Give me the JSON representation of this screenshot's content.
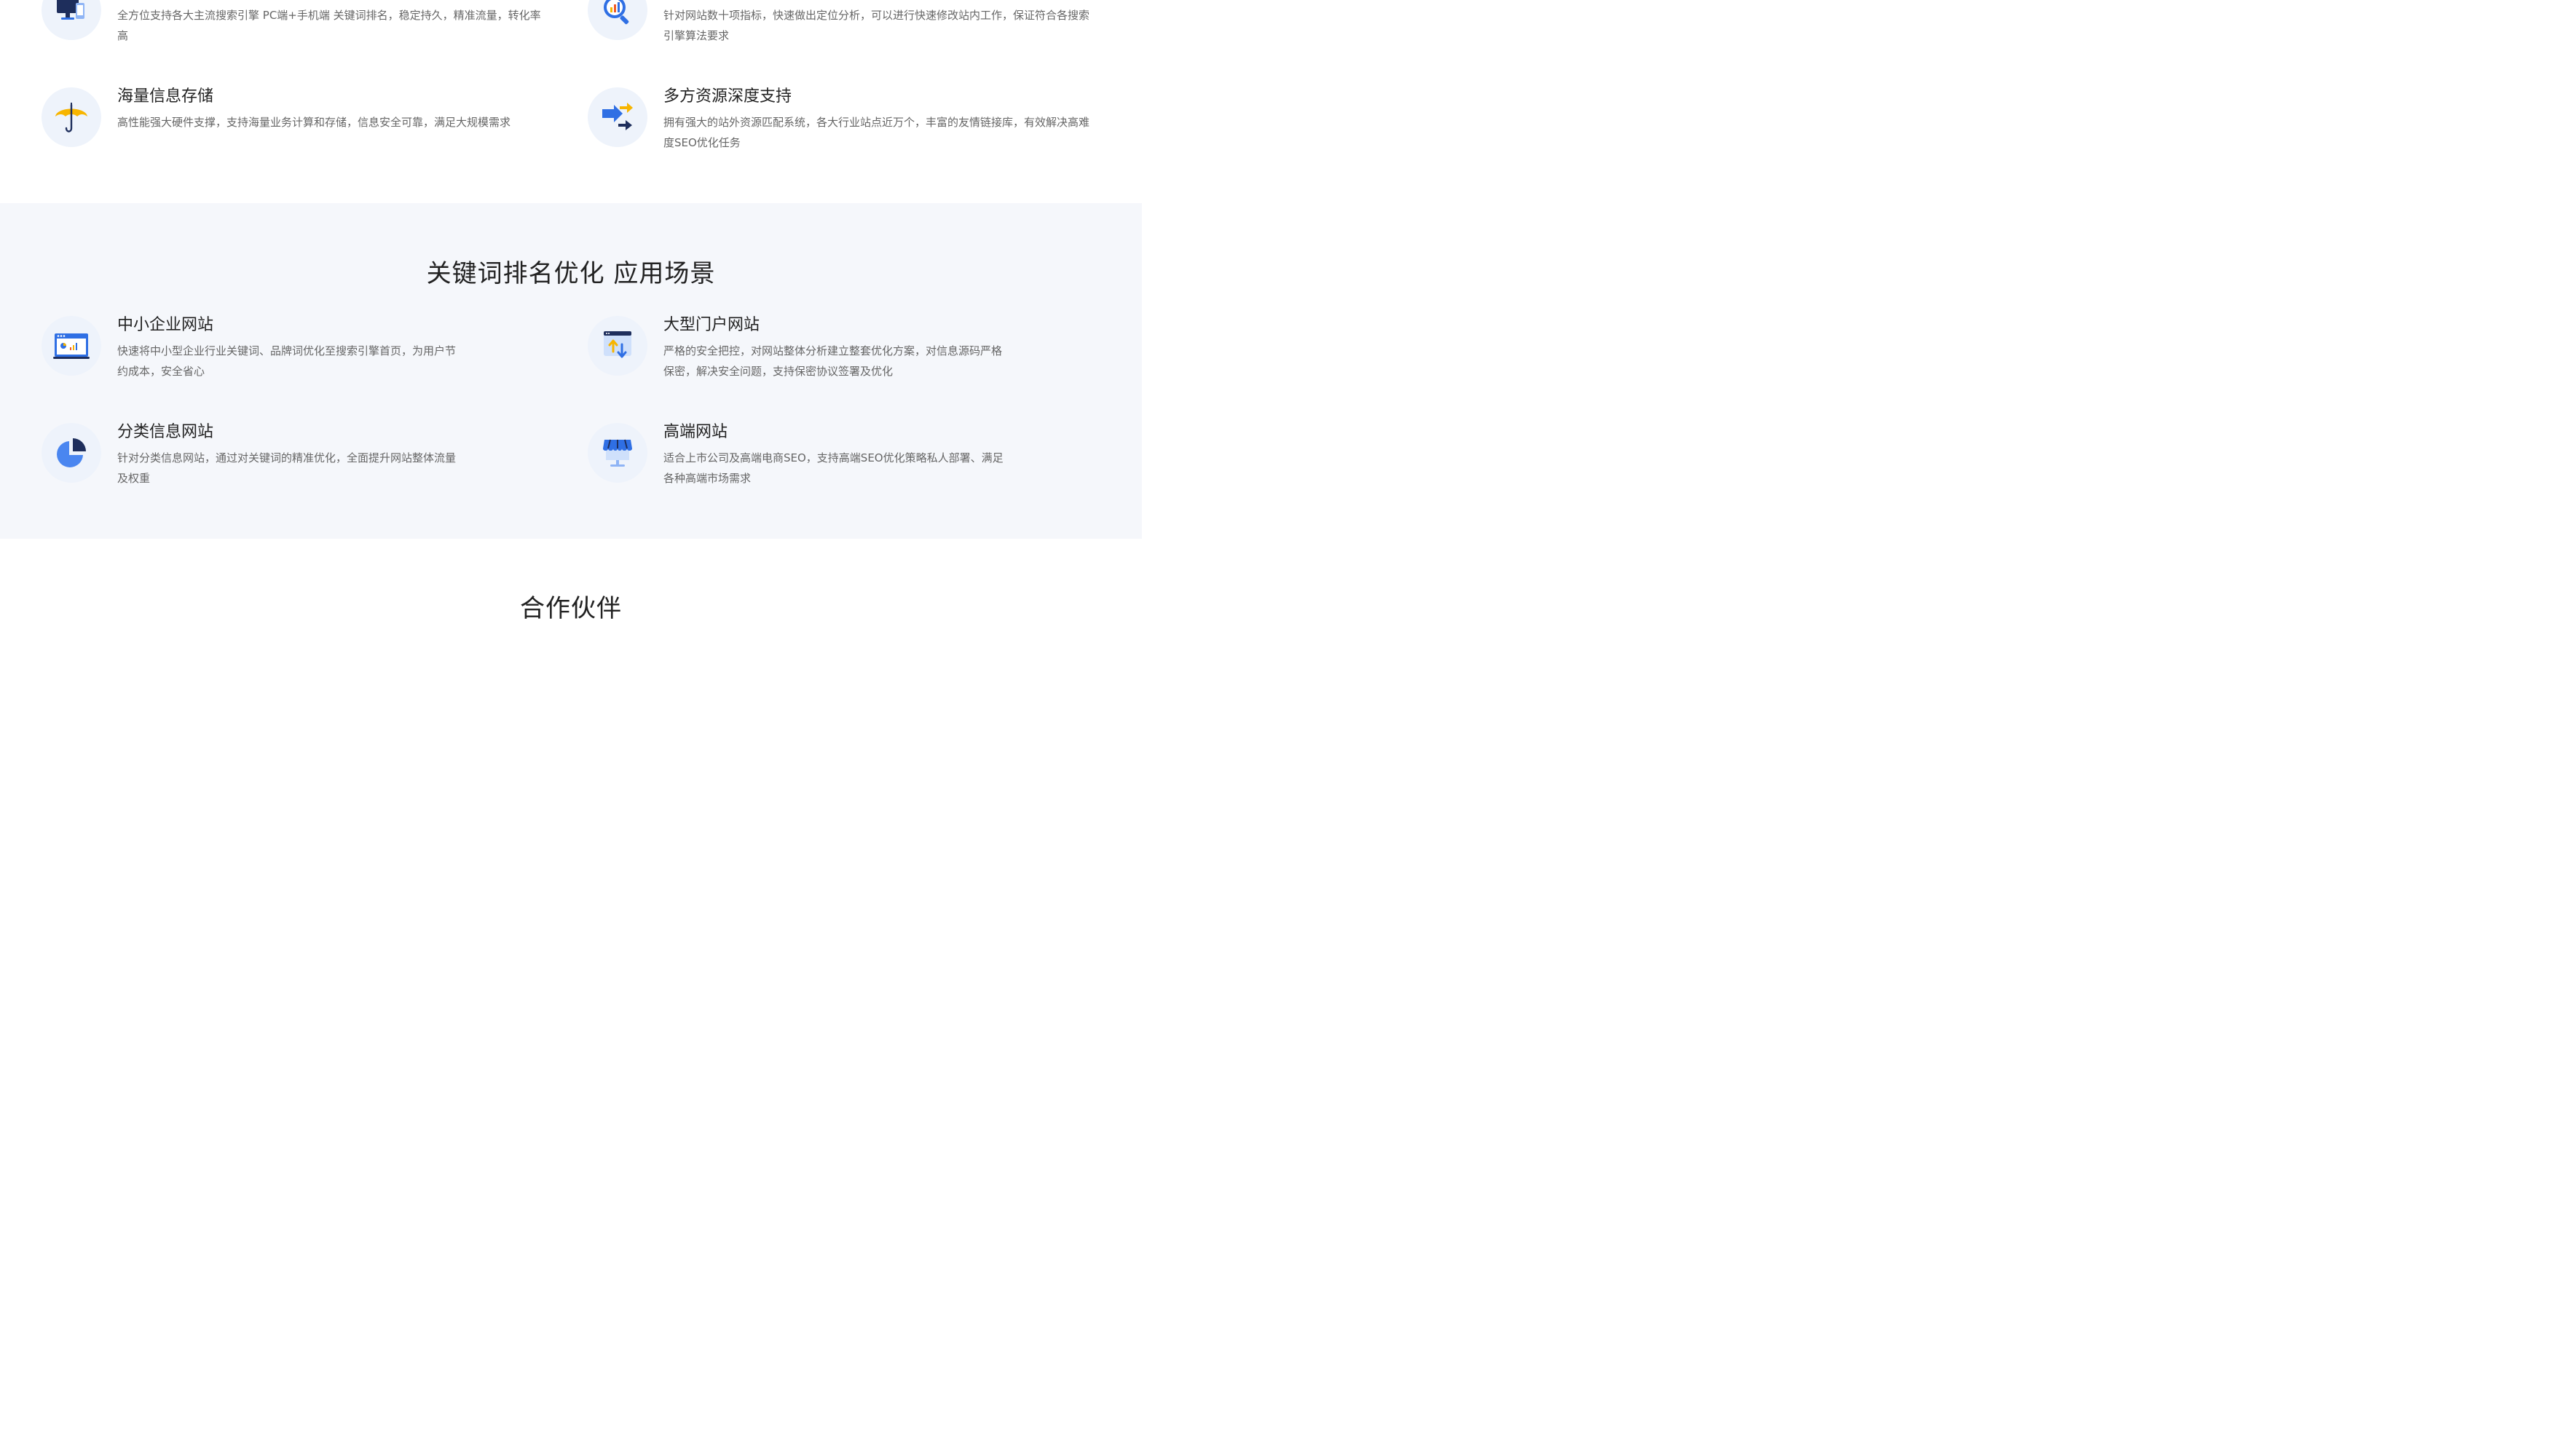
{
  "top_features": {
    "items": [
      {
        "title": "",
        "desc": "全方位支持各大主流搜索引擎 PC端+手机端 关键词排名，稳定持久，精准流量，转化率高",
        "icon": "desktop-mobile-icon"
      },
      {
        "title": "",
        "desc": "针对网站数十项指标，快速做出定位分析，可以进行快速修改站内工作，保证符合各搜索引擎算法要求",
        "icon": "magnifier-chart-icon"
      },
      {
        "title": "海量信息存储",
        "desc": "高性能强大硬件支撑，支持海量业务计算和存储，信息安全可靠，满足大规模需求",
        "icon": "umbrella-icon"
      },
      {
        "title": "多方资源深度支持",
        "desc": "拥有强大的站外资源匹配系统，各大行业站点近万个，丰富的友情链接库，有效解决高难度SEO优化任务",
        "icon": "arrows-exchange-icon"
      }
    ]
  },
  "scenarios": {
    "title": "关键词排名优化 应用场景",
    "items": [
      {
        "title": "中小企业网站",
        "desc": "快速将中小型企业行业关键词、品牌词优化至搜索引擎首页，为用户节约成本，安全省心",
        "icon": "browser-window-icon"
      },
      {
        "title": "大型门户网站",
        "desc": "严格的安全把控，对网站整体分析建立整套优化方案，对信息源码严格保密，解决安全问题，支持保密协议签署及优化",
        "icon": "upload-download-icon"
      },
      {
        "title": "分类信息网站",
        "desc": "针对分类信息网站，通过对关键词的精准优化，全面提升网站整体流量及权重",
        "icon": "pie-chart-icon"
      },
      {
        "title": "高端网站",
        "desc": "适合上市公司及高端电商SEO，支持高端SEO优化策略私人部署、满足各种高端市场需求",
        "icon": "storefront-icon"
      }
    ]
  },
  "partners": {
    "title": "合作伙伴"
  },
  "colors": {
    "accent_blue": "#2f6fe4",
    "dark_navy": "#1e2e5c",
    "accent_orange": "#f7b500",
    "band_bg": "#f5f7fb",
    "icon_bg": "#eef3fb"
  }
}
